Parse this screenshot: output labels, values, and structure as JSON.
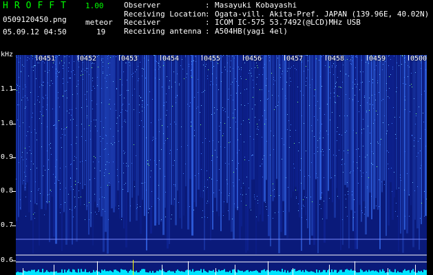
{
  "app": {
    "title": "HROFFT",
    "version": "1.00"
  },
  "file": {
    "name": "0509120450.png",
    "datetime": "05.09.12 04:50"
  },
  "mode": {
    "label": "meteor",
    "count": "19"
  },
  "info": [
    {
      "key": "Observer",
      "value": "Masayuki Kobayashi"
    },
    {
      "key": "Receiving Location",
      "value": "Ogata-vill. Akita-Pref. JAPAN (139.96E, 40.02N)"
    },
    {
      "key": "Receiver",
      "value": "ICOM IC-575 53.7492(@LCD)MHz USB"
    },
    {
      "key": "Receiving antenna",
      "value": "A504HB(yagi 4el)"
    }
  ],
  "axis": {
    "unit": "kHz",
    "freq_labels": [
      "1.1",
      "1.0",
      "0.9",
      "0.8",
      "0.7",
      "0.6"
    ],
    "time_labels": [
      "0451",
      "0452",
      "0453",
      "0454",
      "0455",
      "0456",
      "0457",
      "0458",
      "0459",
      "0500"
    ]
  },
  "colors": {
    "accent": "#00ff00",
    "spectrum_base": "#0a1a7a",
    "signal_bar": "#00e5ff",
    "spike": "#ffff00"
  }
}
